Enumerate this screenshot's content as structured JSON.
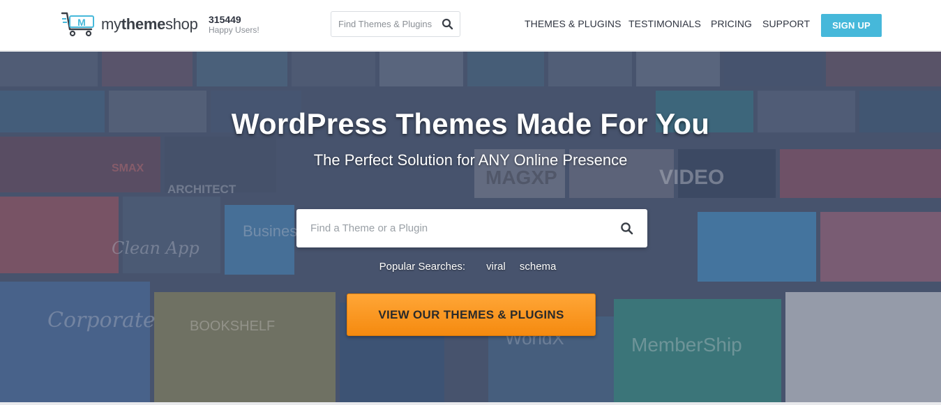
{
  "brand": {
    "logo_letter": "M",
    "name_part1": "my",
    "name_part2": "theme",
    "name_part3": "shop",
    "accent_color": "#46b8da"
  },
  "users": {
    "count": "315449",
    "label": "Happy Users!"
  },
  "header_search": {
    "placeholder": "Find Themes & Plugins",
    "icon": "search-icon"
  },
  "nav": {
    "items": [
      {
        "label": "THEMES & PLUGINS"
      },
      {
        "label": "TESTIMONIALS"
      },
      {
        "label": "PRICING"
      },
      {
        "label": "SUPPORT"
      }
    ],
    "signup_label": "SIGN UP"
  },
  "hero": {
    "title": "WordPress Themes Made For You",
    "subtitle": "The Perfect Solution for ANY Online Presence",
    "search_placeholder": "Find a Theme or a Plugin",
    "popular_label": "Popular Searches:",
    "popular_links": [
      "viral",
      "schema"
    ],
    "cta_label": "VIEW OUR THEMES & PLUGINS",
    "cta_color": "#f7941d",
    "background_tiles": [
      "Corporate",
      "BOOKSHELF",
      "ARCHITECT",
      "VIDEO",
      "MAGXP",
      "Business",
      "MemberShip",
      "WorldX",
      "Clean App",
      "SMAX"
    ]
  }
}
